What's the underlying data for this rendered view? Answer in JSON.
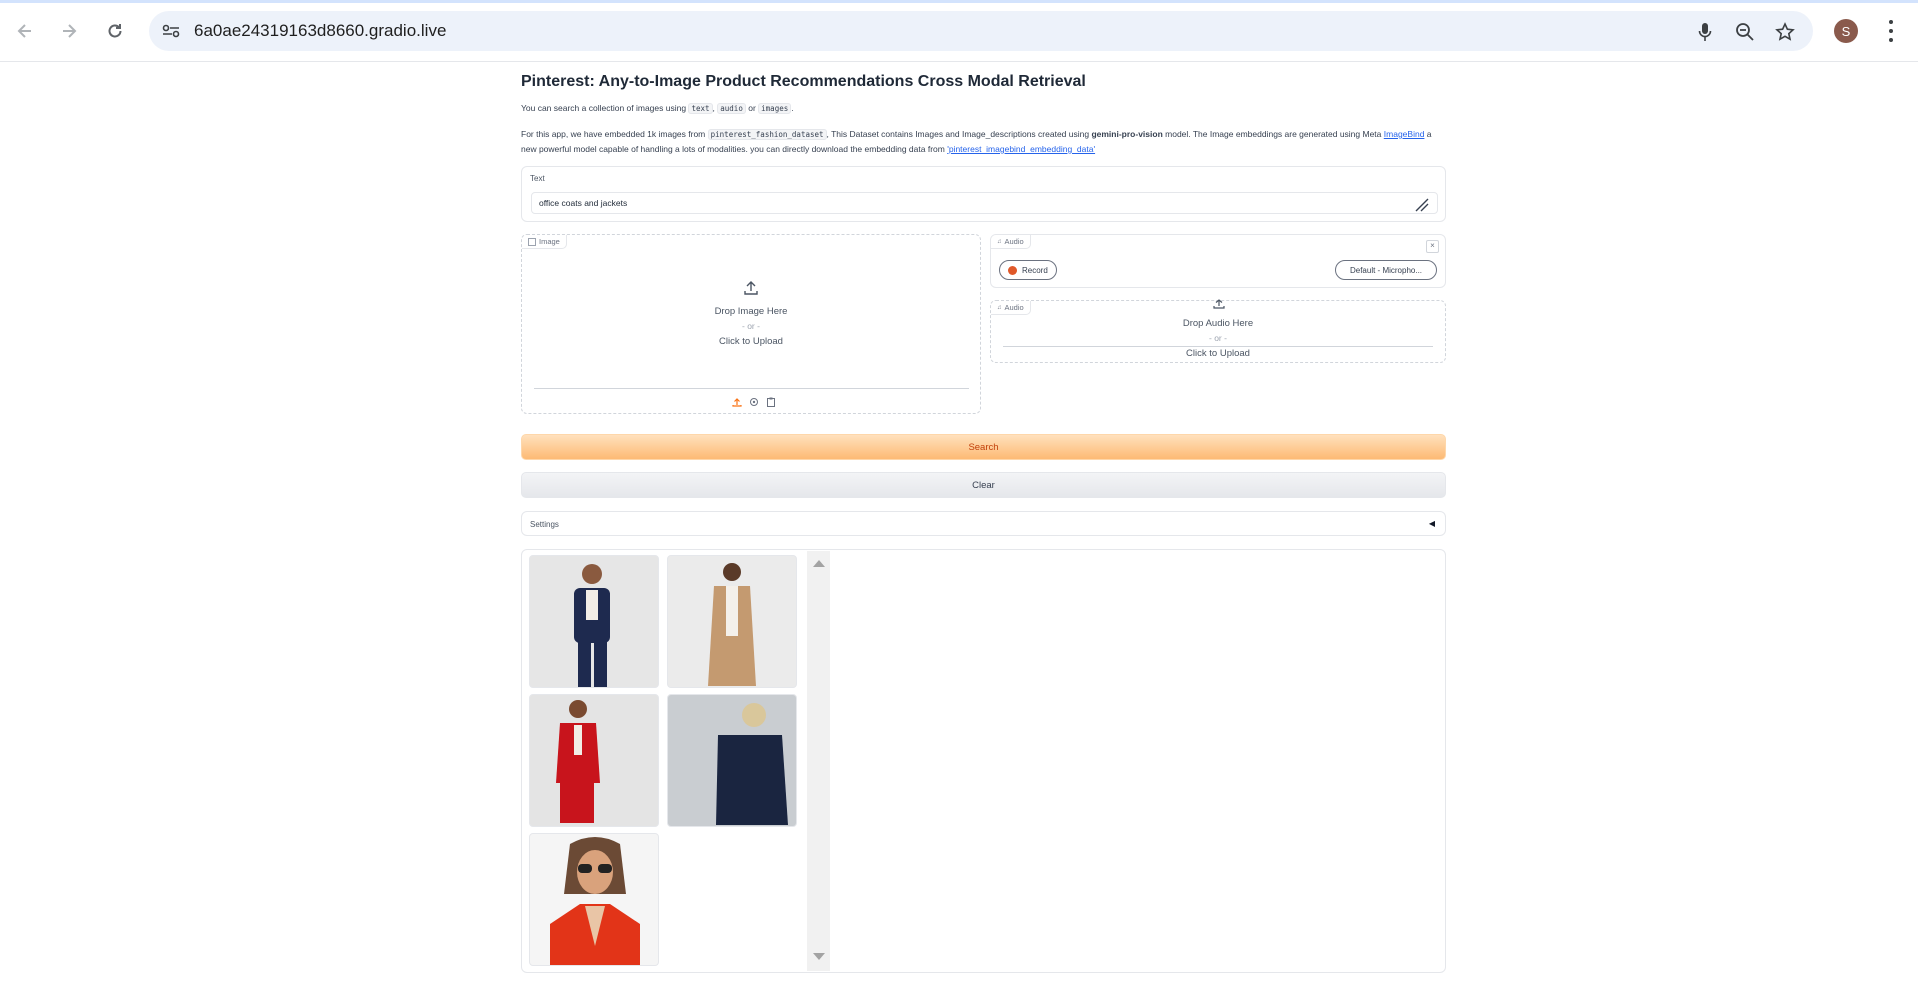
{
  "browser": {
    "url": "6a0ae24319163d8660.gradio.live",
    "profile_initial": "S"
  },
  "app": {
    "title": "Pinterest: Any-to-Image Product Recommendations Cross Modal Retrieval",
    "desc1_prefix": "You can search a collection of images using",
    "desc1_code1": "text",
    "desc1_sep1": ",",
    "desc1_code2": "audio",
    "desc1_sep2": "or",
    "desc1_code3": "images",
    "desc1_end": ".",
    "desc2_a": "For this app, we have embedded 1k images from",
    "desc2_code": "pinterest_fashion_dataset",
    "desc2_b": ", This Dataset contains Images and Image_descriptions created using",
    "desc2_bold": "gemini-pro-vision",
    "desc2_c": "model. The Image embeddings are generated using Meta",
    "desc2_link1": "ImageBind",
    "desc2_d": "a new powerful model capable of handling a lots of modalities. you can directly download the embedding data from",
    "desc2_link2": "'pinterest_imagebind_embedding_data'",
    "text_block": {
      "label": "Text",
      "value": "office coats and jackets"
    },
    "image_block": {
      "label": "Image",
      "drop": "Drop Image Here",
      "or": "- or -",
      "click": "Click to Upload"
    },
    "audio_record": {
      "label": "Audio",
      "record": "Record",
      "device": "Default - Micropho..."
    },
    "audio_upload": {
      "label": "Audio",
      "drop": "Drop Audio Here",
      "or": "- or -",
      "click": "Click to Upload"
    },
    "search_label": "Search",
    "clear_label": "Clear",
    "settings_label": "Settings",
    "gallery_items": [
      "navy pantsuit",
      "camel long coat",
      "red blazer and skirt",
      "navy blazer",
      "red blazer with sunglasses"
    ]
  },
  "colors": {
    "accent": "#f97316",
    "link": "#2563eb",
    "record_dot": "#e0592a"
  }
}
